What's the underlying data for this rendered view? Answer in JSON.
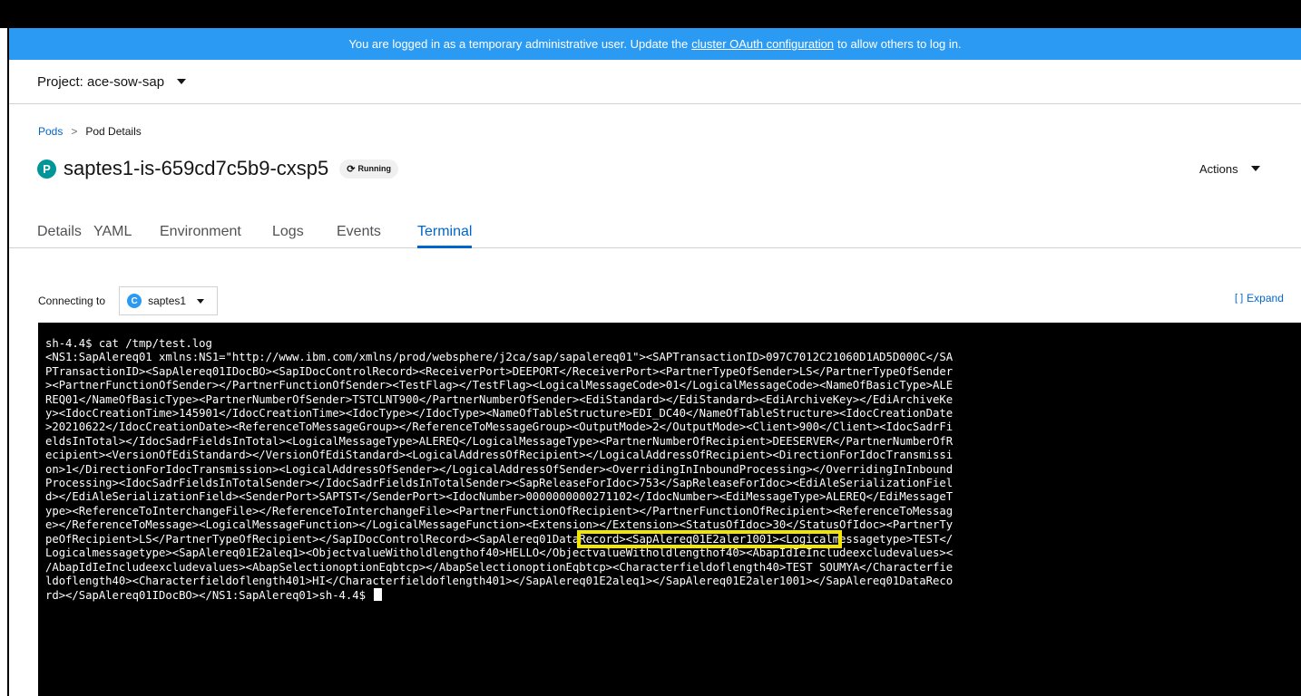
{
  "banner": {
    "text_before": "You are logged in as a temporary administrative user. Update the",
    "link": "cluster OAuth configuration",
    "text_after": "to allow others to log in."
  },
  "project": {
    "label": "Project: ace-sow-sap"
  },
  "breadcrumb": {
    "parent": "Pods",
    "separator": ">",
    "current": "Pod Details"
  },
  "pod": {
    "badge": "P",
    "name": "saptes1-is-659cd7c5b9-cxsp5",
    "status": "Running"
  },
  "actions": {
    "label": "Actions"
  },
  "tabs": [
    {
      "label": "Details"
    },
    {
      "label": "YAML"
    },
    {
      "label": "Environment"
    },
    {
      "label": "Logs"
    },
    {
      "label": "Events"
    },
    {
      "label": "Terminal",
      "active": true
    }
  ],
  "terminal_header": {
    "connecting_label": "Connecting to",
    "container_badge": "C",
    "container": "saptes1",
    "expand_label": "Expand"
  },
  "terminal": {
    "lines": [
      "sh-4.4$ cat /tmp/test.log",
      "<NS1:SapAlereq01 xmlns:NS1=\"http://www.ibm.com/xmlns/prod/websphere/j2ca/sap/sapalereq01\"><SAPTransactionID>097C7012C21060D1AD5D000C</SA",
      "PTransactionID><SapAlereq01IDocBO><SapIDocControlRecord><ReceiverPort>DEEPORT</ReceiverPort><PartnerTypeOfSender>LS</PartnerTypeOfSender",
      "><PartnerFunctionOfSender></PartnerFunctionOfSender><TestFlag></TestFlag><LogicalMessageCode>01</LogicalMessageCode><NameOfBasicType>ALE",
      "REQ01</NameOfBasicType><PartnerNumberOfSender>TSTCLNT900</PartnerNumberOfSender><EdiStandard></EdiStandard><EdiArchiveKey></EdiArchiveKe",
      "y><IdocCreationTime>145901</IdocCreationTime><IdocType></IdocType><NameOfTableStructure>EDI_DC40</NameOfTableStructure><IdocCreationDate",
      ">20210622</IdocCreationDate><ReferenceToMessageGroup></ReferenceToMessageGroup><OutputMode>2</OutputMode><Client>900</Client><IdocSadrFi",
      "eldsInTotal></IdocSadrFieldsInTotal><LogicalMessageType>ALEREQ</LogicalMessageType><PartnerNumberOfRecipient>DEESERVER</PartnerNumberOfR",
      "ecipient><VersionOfEdiStandard></VersionOfEdiStandard><LogicalAddressOfRecipient></LogicalAddressOfRecipient><DirectionForIdocTransmissi",
      "on>1</DirectionForIdocTransmission><LogicalAddressOfSender></LogicalAddressOfSender><OverridingInInboundProcessing></OverridingInInbound",
      "Processing><IdocSadrFieldsInTotalSender></IdocSadrFieldsInTotalSender><SapReleaseForIdoc>753</SapReleaseForIdoc><EdiAleSerializationFiel",
      "d></EdiAleSerializationField><SenderPort>SAPTST</SenderPort><IdocNumber>0000000000271102</IdocNumber><EdiMessageType>ALEREQ</EdiMessageT",
      "ype><ReferenceToInterchangeFile></ReferenceToInterchangeFile><PartnerFunctionOfRecipient></PartnerFunctionOfRecipient><ReferenceToMessag",
      "e></ReferenceToMessage><LogicalMessageFunction></LogicalMessageFunction><Extension></Extension><StatusOfIdoc>30</StatusOfIdoc><PartnerTy",
      "peOfRecipient>LS</PartnerTypeOfRecipient></SapIDocControlRecord><SapAlereq01DataRecord><SapAlereq01E2aler1001><Logicalmessagetype>TEST</",
      "Logicalmessagetype><SapAlereq01E2aleq1><ObjectvalueWitholdlengthof40>HELLO</ObjectvalueWitholdlengthof40><AbapIdIeIncludeexcludevalues><",
      "/AbapIdIeIncludeexcludevalues><AbapSelectionoptionEqbtcp></AbapSelectionoptionEqbtcp><Characterfieldoflength40>TEST SOUMYA</Characterfie",
      "ldoflength40><Characterfieldoflength401>HI</Characterfieldoflength401></SapAlereq01E2aleq1></SapAlereq01E2aler1001></SapAlereq01DataReco",
      "rd></SapAlereq01IDocBO></NS1:SapAlereq01>sh-4.4$ "
    ]
  },
  "colors": {
    "banner": "#2b9af3",
    "link": "#0066cc",
    "highlight": "#f2e600",
    "terminal_bg": "#000000",
    "pod_badge": "#009596"
  }
}
